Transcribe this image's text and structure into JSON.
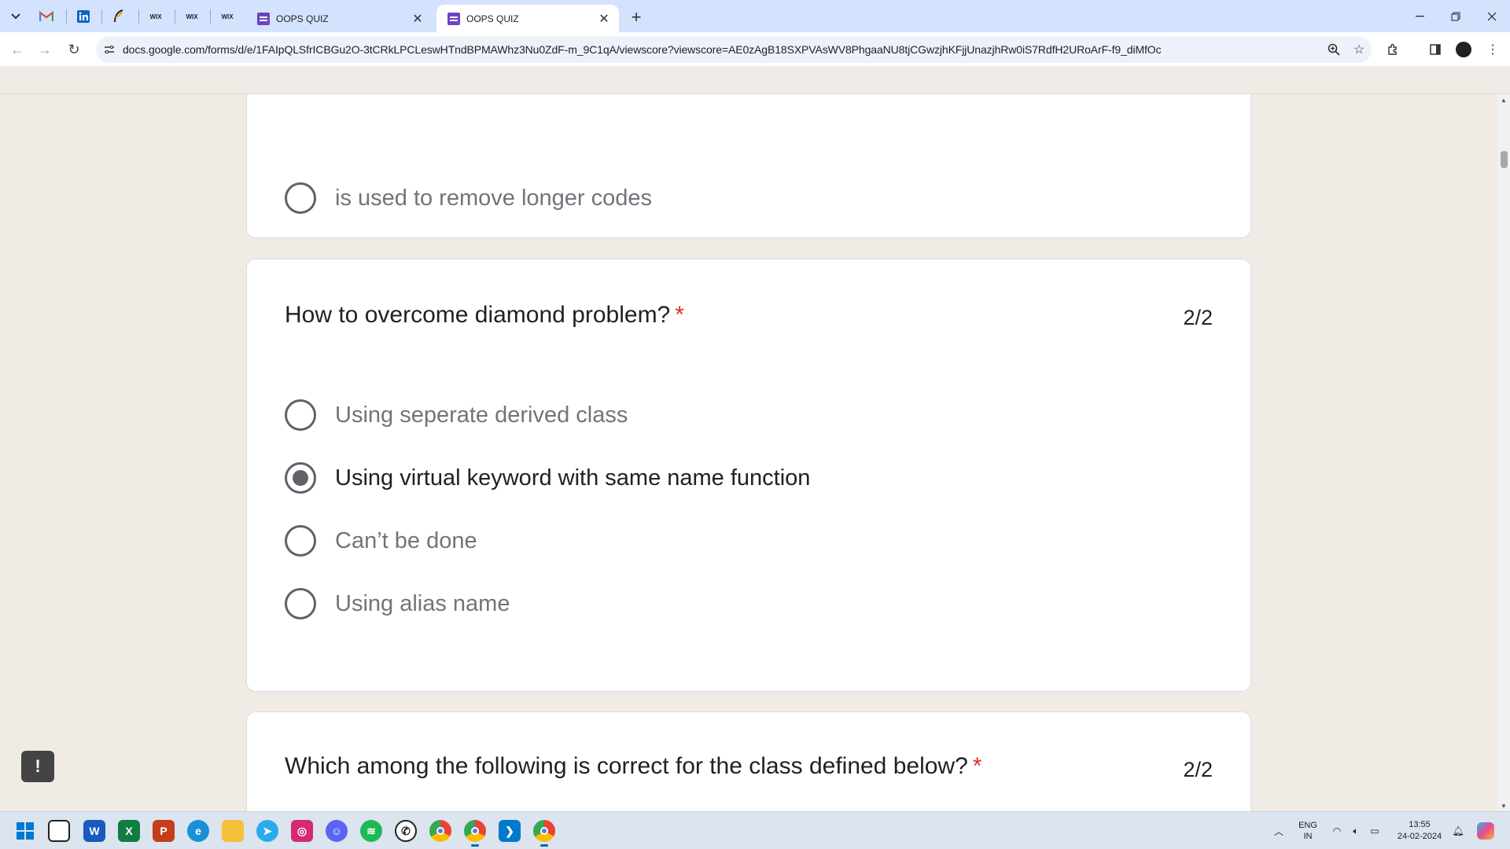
{
  "browser": {
    "pinned_tabs": [
      {
        "name": "gmail",
        "icon": "gmail-icon"
      },
      {
        "name": "linkedin",
        "icon": "linkedin-icon"
      },
      {
        "name": "site",
        "icon": "feather-icon"
      },
      {
        "name": "wix-1",
        "label": "WIX"
      },
      {
        "name": "wix-2",
        "label": "WIX"
      },
      {
        "name": "wix-3",
        "label": "WIX"
      }
    ],
    "tabs": [
      {
        "title": "OOPS QUIZ",
        "active": false
      },
      {
        "title": "OOPS QUIZ",
        "active": true
      }
    ],
    "url": "docs.google.com/forms/d/e/1FAIpQLSfrICBGu2O-3tCRkLPCLeswHTndBPMAWhz3Nu0ZdF-m_9C1qA/viewscore?viewscore=AE0zAgB18SXPVAsWV8PhgaaNU8tjCGwzjhKFjjUnazjhRw0iS7RdfH2URoArF-f9_diMfOc"
  },
  "form": {
    "question_1": {
      "options": [
        {
          "text": "is used to remove longer codes",
          "selected": false
        }
      ]
    },
    "question_2": {
      "title": "How to overcome diamond problem?",
      "required_mark": "*",
      "score": "2/2",
      "options": [
        {
          "text": "Using seperate derived class",
          "selected": false
        },
        {
          "text": "Using virtual keyword with same name function",
          "selected": true
        },
        {
          "text": "Can’t be done",
          "selected": false
        },
        {
          "text": "Using alias name",
          "selected": false
        }
      ]
    },
    "question_3": {
      "title": "Which among the following is correct for the class defined below?",
      "required_mark": "*",
      "score": "2/2"
    },
    "feedback_label": "!"
  },
  "taskbar": {
    "apps": [
      "windows-start",
      "file-explorer-alt",
      "word",
      "excel",
      "powerpoint",
      "edge-like",
      "file-explorer",
      "telegram",
      "instagram",
      "discord",
      "spotify",
      "whatsapp",
      "chrome",
      "chrome-profile",
      "vscode",
      "chrome-active"
    ],
    "lang_top": "ENG",
    "lang_bottom": "IN",
    "time": "13:55",
    "date": "24-02-2024"
  },
  "colors": {
    "page_bg": "#f0ebe5",
    "required": "#d93025",
    "radio": "#5f6368",
    "tabstrip": "#d3e3fd"
  }
}
